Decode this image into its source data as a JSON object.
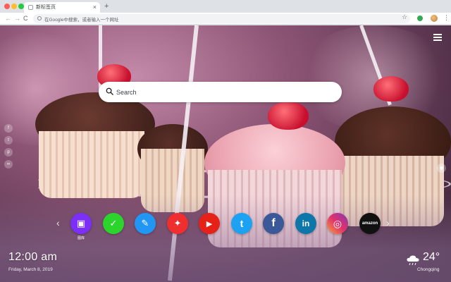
{
  "browser": {
    "tab": {
      "title": "新标签页",
      "close_glyph": "×"
    },
    "new_tab_glyph": "+",
    "nav": {
      "back_glyph": "←",
      "forward_glyph": "→",
      "reload_glyph": "C"
    },
    "omnibox": {
      "text": "在Google中搜索，或者输入一个网址"
    },
    "star_glyph": "☆",
    "menu_glyph": "⋮",
    "colors": {
      "tabbar": "#dee1e6",
      "toolbar": "#ffffff",
      "omnibox": "#f1f3f4"
    }
  },
  "page": {
    "menu_icon": "hamburger-icon",
    "search": {
      "placeholder": "Search"
    },
    "side_icons": [
      {
        "name": "facebook-small-icon",
        "glyph": "f"
      },
      {
        "name": "twitter-small-icon",
        "glyph": "t"
      },
      {
        "name": "pinterest-small-icon",
        "glyph": "p"
      },
      {
        "name": "link-small-icon",
        "glyph": "∞"
      }
    ],
    "side_right_glyph": "◉",
    "dock": {
      "prev_glyph": "‹",
      "next_glyph": "›",
      "apps": [
        {
          "name": "gallery-app",
          "glyph": "▣",
          "label": "图库",
          "color": "#7b2ff7"
        },
        {
          "name": "tasks-app",
          "glyph": "✓",
          "label": "",
          "color": "#2bd52b"
        },
        {
          "name": "notes-app",
          "glyph": "✎",
          "label": "",
          "color": "#2196f3"
        },
        {
          "name": "game-app",
          "glyph": "✦",
          "label": "",
          "color": "#ef2f2f"
        },
        {
          "name": "youtube-app",
          "glyph": "▶",
          "label": "",
          "color": "#e62117"
        },
        {
          "name": "twitter-app",
          "glyph": "t",
          "label": "",
          "color": "#1da1f2"
        },
        {
          "name": "facebook-app",
          "glyph": "f",
          "label": "",
          "color": "#3b5998"
        },
        {
          "name": "linkedin-app",
          "glyph": "in",
          "label": "",
          "color": "#0e76a8"
        },
        {
          "name": "instagram-app",
          "glyph": "◎",
          "label": "",
          "color": "#d6249f"
        },
        {
          "name": "amazon-app",
          "glyph": "amazon",
          "label": "",
          "color": "#111111"
        }
      ]
    },
    "clock": {
      "time": "12:00 am",
      "date": "Friday, March 8, 2019"
    },
    "weather": {
      "temp": "24°",
      "city": "Chongqing",
      "icon": "cloud-rain-icon"
    }
  }
}
